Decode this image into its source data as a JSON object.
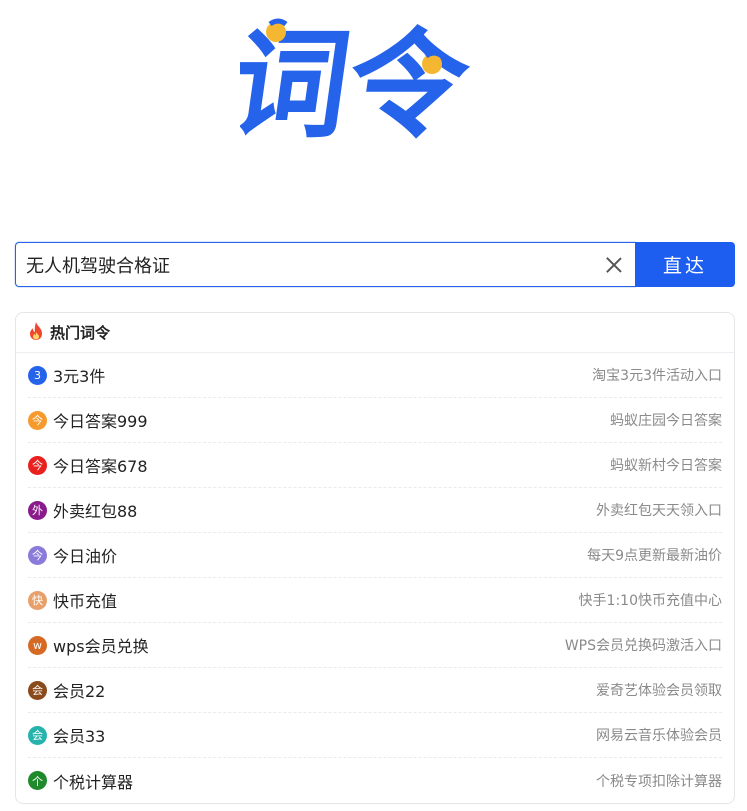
{
  "logo": {
    "text": "词令",
    "primary_color": "#2563eb",
    "dot_color": "#f5b731"
  },
  "search": {
    "value": "无人机驾驶合格证",
    "clear_icon": "close-icon",
    "button_label": "直达",
    "accent": "#1d5ef0"
  },
  "hot": {
    "icon": "flame-icon",
    "title": "热门词令",
    "items": [
      {
        "badge": "3",
        "badge_color": "#2563eb",
        "command": "3元3件",
        "desc": "淘宝3元3件活动入口"
      },
      {
        "badge": "今",
        "badge_color": "#f79a2e",
        "command": "今日答案999",
        "desc": "蚂蚁庄园今日答案"
      },
      {
        "badge": "今",
        "badge_color": "#e8201e",
        "command": "今日答案678",
        "desc": "蚂蚁新村今日答案"
      },
      {
        "badge": "外",
        "badge_color": "#8a1b8c",
        "command": "外卖红包88",
        "desc": "外卖红包天天领入口"
      },
      {
        "badge": "今",
        "badge_color": "#8a7ad9",
        "command": "今日油价",
        "desc": "每天9点更新最新油价"
      },
      {
        "badge": "快",
        "badge_color": "#e8a06a",
        "command": "快币充值",
        "desc": "快手1:10快币充值中心"
      },
      {
        "badge": "w",
        "badge_color": "#d46a24",
        "command": "wps会员兑换",
        "desc": "WPS会员兑换码激活入口"
      },
      {
        "badge": "会",
        "badge_color": "#8a4a1c",
        "command": "会员22",
        "desc": "爱奇艺体验会员领取"
      },
      {
        "badge": "会",
        "badge_color": "#27b3ad",
        "command": "会员33",
        "desc": "网易云音乐体验会员"
      },
      {
        "badge": "个",
        "badge_color": "#1f8a2c",
        "command": "个税计算器",
        "desc": "个税专项扣除计算器"
      }
    ]
  }
}
